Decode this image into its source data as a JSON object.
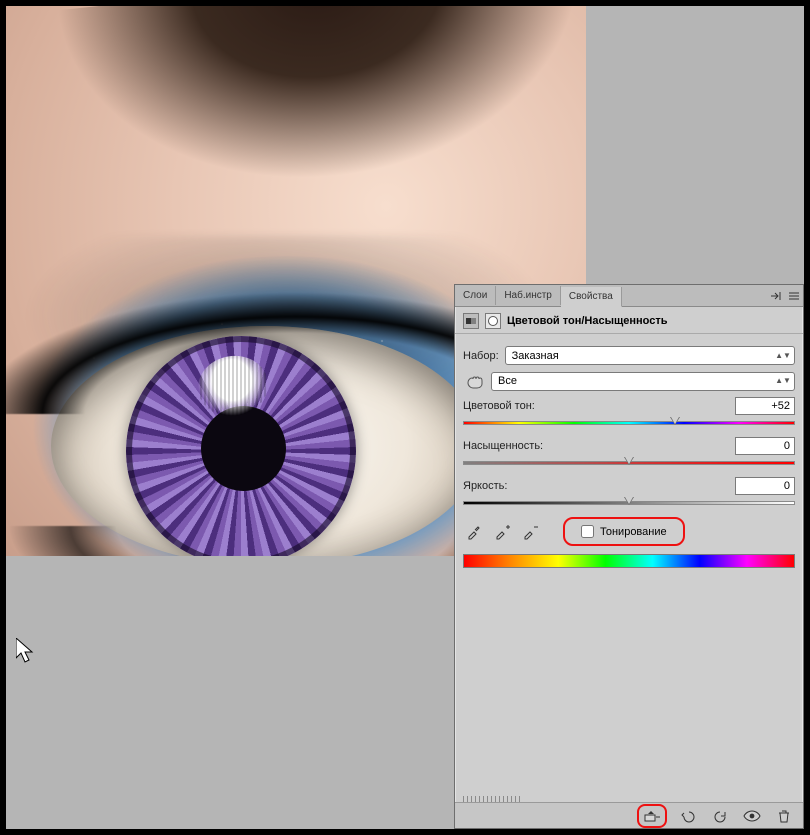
{
  "tabs": {
    "layers": "Слои",
    "toolpresets": "Наб.инстр",
    "properties": "Свойства"
  },
  "panel": {
    "title": "Цветовой тон/Насыщенность",
    "preset_label": "Набор:",
    "preset_value": "Заказная",
    "channel_value": "Все",
    "hue": {
      "label": "Цветовой тон:",
      "value": "+52",
      "percent": 64
    },
    "sat": {
      "label": "Насыщенность:",
      "value": "0",
      "percent": 50
    },
    "light": {
      "label": "Яркость:",
      "value": "0",
      "percent": 50
    },
    "colorize_label": "Тонирование"
  },
  "icons": {
    "adjustment": "adjustment-icon",
    "mask": "mask-icon",
    "hand": "hand-scrubby-icon",
    "eyedropper": "eyedropper-icon",
    "eyedropper_plus": "eyedropper-plus-icon",
    "eyedropper_minus": "eyedropper-minus-icon",
    "clip": "clip-to-layer-icon",
    "prev": "previous-state-icon",
    "reset": "reset-icon",
    "eye": "visibility-icon",
    "trash": "trash-icon",
    "collapse": "collapse-icon",
    "menu": "panel-menu-icon"
  }
}
